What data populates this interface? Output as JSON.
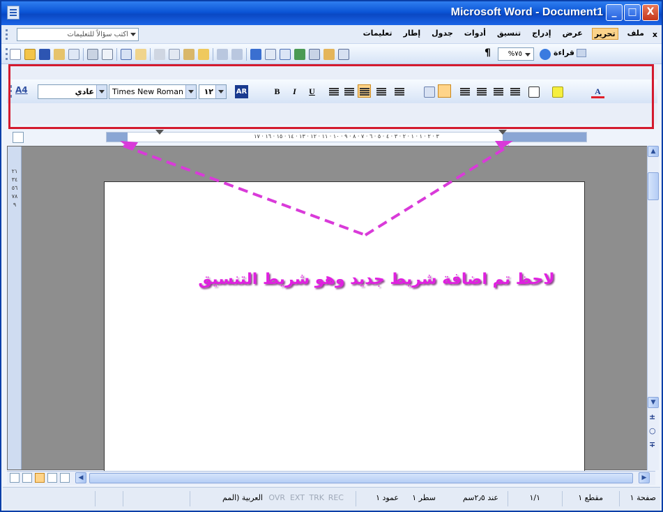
{
  "window": {
    "title": "Microsoft Word - Document1",
    "minimize": "_",
    "maximize": "□",
    "close": "X"
  },
  "menu": {
    "close_doc": "x",
    "items": [
      "ملف",
      "تحرير",
      "عرض",
      "إدراج",
      "تنسيق",
      "أدوات",
      "جدول",
      "إطار",
      "تعليمات"
    ],
    "active_index": 1,
    "help_placeholder": "اكتب سؤالاً للتعليمات"
  },
  "standard_toolbar": {
    "zoom": "٧٥%",
    "read_button": "قراءة",
    "show_formatting_symbol": "¶",
    "icons": [
      "new-icon",
      "open-icon",
      "save-icon",
      "permission-icon",
      "email-icon",
      "print-icon",
      "print-preview-icon",
      "spelling-icon",
      "research-icon",
      "cut-icon",
      "copy-icon",
      "paste-icon",
      "format-painter-icon",
      "undo-icon",
      "redo-icon",
      "hyperlink-icon",
      "tables-borders-icon",
      "insert-table-icon",
      "insert-excel-icon",
      "columns-icon",
      "drawing-icon",
      "document-map-icon",
      "help-icon"
    ]
  },
  "formatting_toolbar": {
    "style_icon": "A4",
    "style": "عادي",
    "font": "Times New Roman",
    "size": "١٢",
    "language_button": "AR",
    "bold": "B",
    "italic": "I",
    "underline": "U",
    "font_color_letter": "A",
    "accent_highlight": "#ffd489",
    "annotation_box_color": "#d41a2e"
  },
  "ruler": {
    "text": "٣ · ٢ · ١ · ١ · ٢ · ٣ · ٤ · ٥ · ٦ · ٧ · ٨ · ٩ · ١٠ · ١١ · ١٢ · ١٣ · ١٤ · ١٥ · ١٦ · ١٧",
    "vertical_text": "٢١٣٤٥٦٧٨٩"
  },
  "annotation": {
    "text": "لاحظ تم اضافة شريط جديد وهو شريط التنسيق",
    "color": "#e020e0"
  },
  "statusbar": {
    "page": "صفحة ١",
    "section": "مقطع ١",
    "page_of": "١/١",
    "at": "عند ٢٫٥سم",
    "line": "سطر ١",
    "column": "عمود ١",
    "rec": "REC",
    "trk": "TRK",
    "ext": "EXT",
    "ovr": "OVR",
    "language": "العربية (المم"
  }
}
